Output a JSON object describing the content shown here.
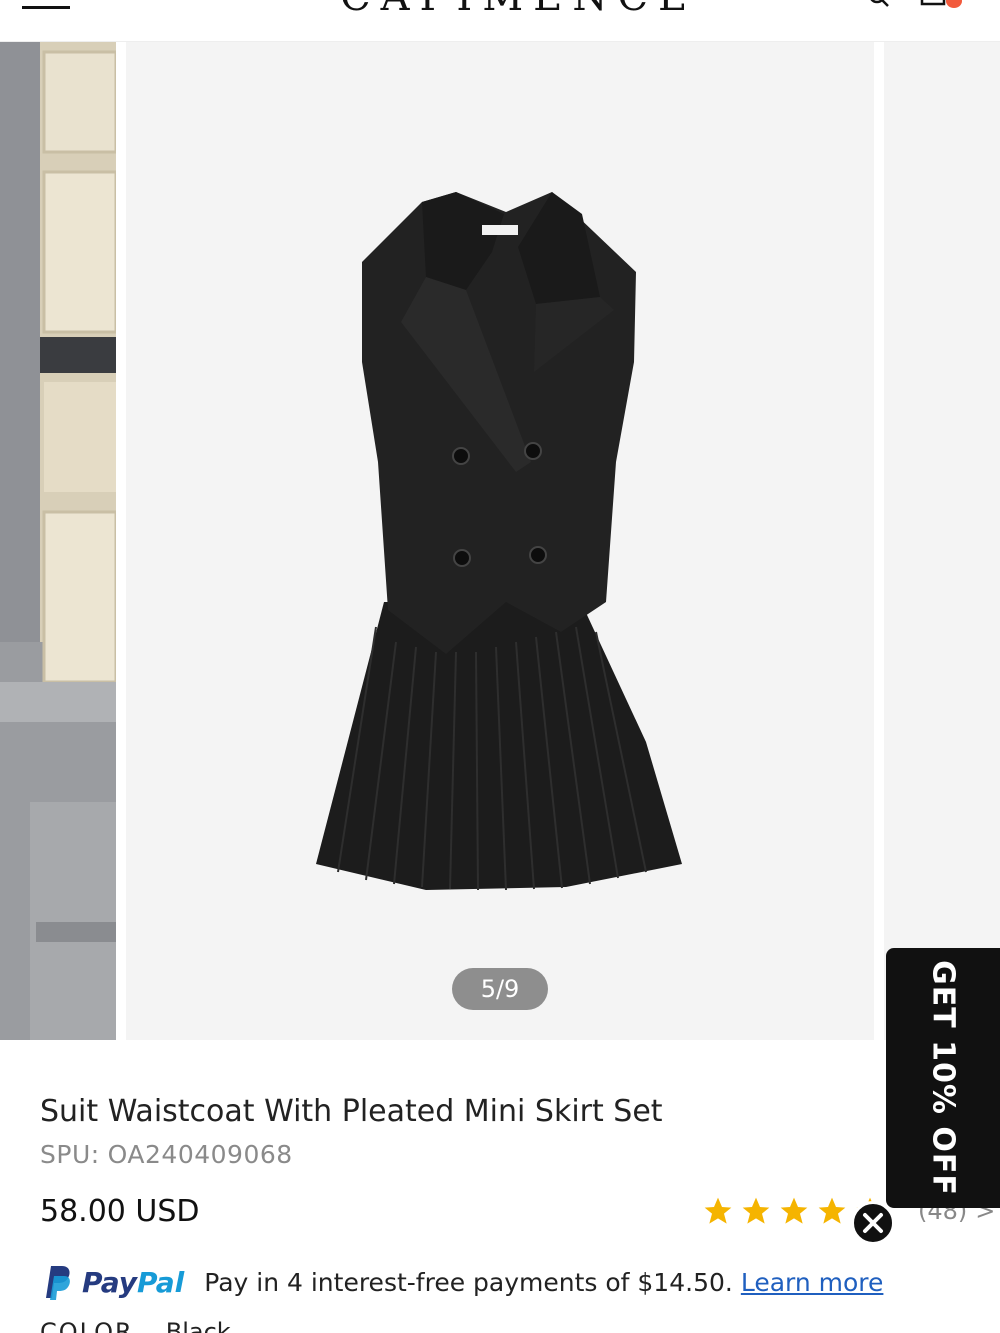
{
  "header": {
    "brand": "CAPIMENCE",
    "menu_icon": "hamburger-menu-icon",
    "search_icon": "search-icon",
    "cart_icon": "cart-icon"
  },
  "gallery": {
    "counter": "5/9",
    "current": 5,
    "total": 9
  },
  "product": {
    "title": "Suit Waistcoat With Pleated Mini Skirt Set",
    "spu_label": "SPU:",
    "spu_value": "OA240409068",
    "price": "58.00 USD",
    "rating_stars": 5,
    "review_count": "(48)",
    "review_chevron": ">"
  },
  "paypal": {
    "brand_pay": "Pay",
    "brand_pal": "Pal",
    "message": "Pay in 4 interest-free payments of $14.50.",
    "link": "Learn more"
  },
  "options": {
    "color_label": "COLOR",
    "color_value": "Black"
  },
  "promo": {
    "label": "GET 10% OFF"
  },
  "colors": {
    "accent": "#f25a3c",
    "star": "#f5b400",
    "paypal_dark": "#253b80",
    "paypal_light": "#179bd7",
    "link": "#1f5fbf"
  }
}
